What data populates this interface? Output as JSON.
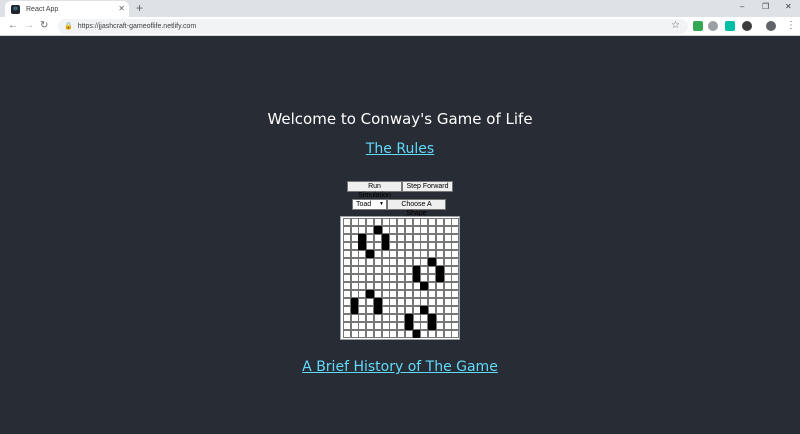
{
  "browser": {
    "tab_title": "React App",
    "tab_favicon": "⚛",
    "url": "https://jjashcraft-gameoflife.netlify.com",
    "window_controls": [
      "–",
      "❐",
      "✕"
    ]
  },
  "page": {
    "title": "Welcome to Conway's Game of Life",
    "rules_link": "The Rules",
    "history_link": "A Brief History of The Game",
    "buttons": {
      "run": "Run Simulation",
      "step": "Step Forward",
      "choose": "Choose A Shape"
    },
    "shape_select": {
      "selected": "Toad"
    }
  },
  "grid": {
    "cols": 15,
    "rows": 15,
    "alive": [
      [
        1,
        4
      ],
      [
        2,
        2
      ],
      [
        2,
        5
      ],
      [
        3,
        2
      ],
      [
        3,
        5
      ],
      [
        4,
        3
      ],
      [
        5,
        11
      ],
      [
        6,
        9
      ],
      [
        6,
        12
      ],
      [
        7,
        9
      ],
      [
        7,
        12
      ],
      [
        8,
        10
      ],
      [
        9,
        3
      ],
      [
        10,
        1
      ],
      [
        10,
        4
      ],
      [
        11,
        1
      ],
      [
        11,
        4
      ],
      [
        11,
        10
      ],
      [
        12,
        8
      ],
      [
        12,
        11
      ],
      [
        13,
        8
      ],
      [
        13,
        11
      ],
      [
        14,
        9
      ]
    ]
  },
  "colors": {
    "background": "#282c34",
    "link": "#61dafb",
    "title": "#ffffff"
  }
}
